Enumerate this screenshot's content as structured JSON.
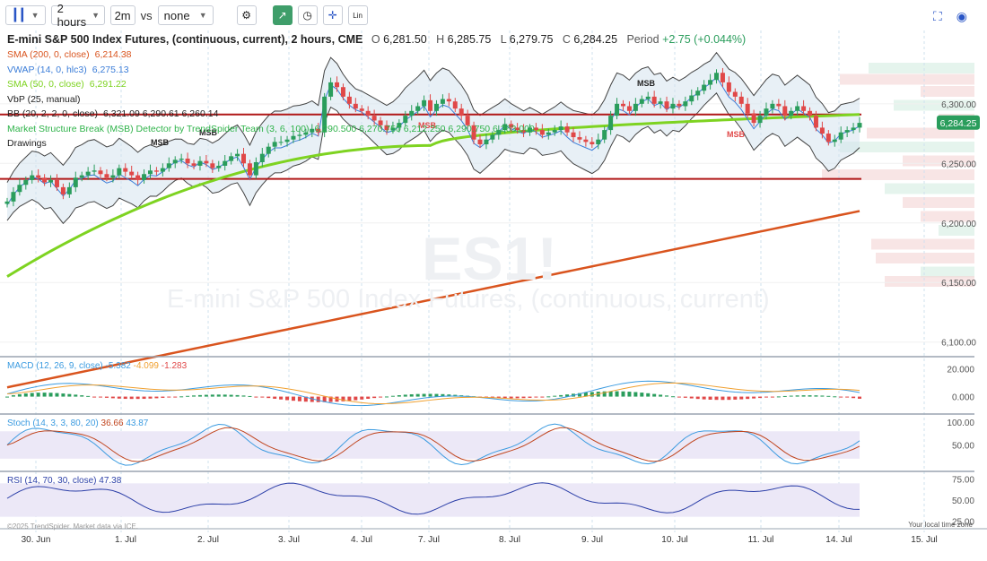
{
  "toolbar": {
    "interval": "2 hours",
    "interval_short": "2m",
    "vs_label": "vs",
    "compare": "none",
    "scale_label": "Lin"
  },
  "header": {
    "title": "E-mini S&P 500 Index Futures, (continuous, current), 2 hours, CME",
    "o_label": "O",
    "o": "6,281.50",
    "h_label": "H",
    "h": "6,285.75",
    "l_label": "L",
    "l": "6,279.75",
    "c_label": "C",
    "c": "6,284.25",
    "period_label": "Period",
    "period": "+2.75 (+0.044%)"
  },
  "legend": [
    {
      "label": "SMA (200, 0, close)",
      "value": "6,214.38",
      "color": "#d9541e"
    },
    {
      "label": "VWAP (14, 0, hlc3)",
      "value": "6,275.13",
      "color": "#3b7dd8"
    },
    {
      "label": "SMA (50, 0, close)",
      "value": "6,291.22",
      "color": "#7ed321"
    },
    {
      "label": "VbP (25, manual)",
      "value": "",
      "color": "#222"
    },
    {
      "label": "BB (20, 2, 2, 0, close)",
      "value": "6,321.09 6,290.61 6,260.14",
      "color": "#222"
    },
    {
      "label": "Market Structure Break (MSB) Detector by TrendSpider Team (3, 6, 100)",
      "value": "6,290.500 6,270.750 6,212.250 6,290.750 6,263.000",
      "color": "#2fb34a"
    },
    {
      "label": "Drawings",
      "value": "",
      "color": "#222"
    }
  ],
  "watermark": {
    "ticker": "ES1!",
    "name": "E-mini S&P 500 Index Futures, (continuous, current)"
  },
  "indicators": {
    "macd": {
      "label": "MACD (12, 26, 9, close)",
      "v1": "-5.382",
      "v2": "-4.099",
      "v3": "-1.283"
    },
    "stoch": {
      "label": "Stoch (14, 3, 3, 80, 20)",
      "v1": "36.66",
      "v2": "43.87"
    },
    "rsi": {
      "label": "RSI (14, 70, 30, close)",
      "v1": "47.38"
    }
  },
  "footer": {
    "copyright": "©2025 TrendSpider. Market data via ICE.",
    "timezone": "Your local time zone"
  },
  "colors": {
    "up": "#2a9d5c",
    "down": "#e04848",
    "sma200": "#d9541e",
    "sma50": "#7ed321",
    "vwap": "#3b7dd8",
    "bb": "#444",
    "macd_line": "#3b9be0",
    "signal_line": "#f0a030",
    "stoch_k": "#3b9be0",
    "stoch_d": "#c0451e",
    "rsi_line": "#2c3fa8",
    "support": "#b01818"
  },
  "chart_data": [
    {
      "type": "line",
      "title": "E-mini S&P 500 Index Futures, (continuous, current), 2 hours, CME",
      "x_ticks": [
        "30. Jun",
        "1. Jul",
        "2. Jul",
        "3. Jul",
        "4. Jul",
        "7. Jul",
        "8. Jul",
        "9. Jul",
        "10. Jul",
        "11. Jul",
        "14. Jul",
        "15. Jul"
      ],
      "y_ticks": [
        6100,
        6150,
        6200,
        6250,
        6300
      ],
      "ylim": [
        6090,
        6342
      ],
      "last_price": "6,284.25",
      "last_value": 6284.25,
      "horizontal_levels": [
        6291,
        6237
      ],
      "close_series": [
        6218,
        6226,
        6232,
        6236,
        6240,
        6238,
        6234,
        6236,
        6230,
        6224,
        6230,
        6238,
        6240,
        6243,
        6244,
        6241,
        6238,
        6240,
        6246,
        6243,
        6240,
        6236,
        6241,
        6244,
        6243,
        6246,
        6250,
        6253,
        6254,
        6250,
        6248,
        6252,
        6250,
        6246,
        6248,
        6252,
        6256,
        6258,
        6250,
        6240,
        6251,
        6258,
        6264,
        6268,
        6268,
        6270,
        6273,
        6274,
        6276,
        6279,
        6276,
        6306,
        6318,
        6314,
        6306,
        6300,
        6296,
        6294,
        6290,
        6286,
        6282,
        6278,
        6280,
        6284,
        6290,
        6294,
        6298,
        6303,
        6294,
        6300,
        6304,
        6302,
        6296,
        6290,
        6282,
        6270,
        6266,
        6270,
        6274,
        6278,
        6283,
        6280,
        6278,
        6276,
        6280,
        6278,
        6274,
        6276,
        6278,
        6281,
        6276,
        6272,
        6270,
        6268,
        6266,
        6270,
        6278,
        6290,
        6300,
        6298,
        6294,
        6300,
        6304,
        6306,
        6300,
        6302,
        6296,
        6300,
        6298,
        6302,
        6307,
        6311,
        6316,
        6320,
        6326,
        6318,
        6310,
        6306,
        6300,
        6292,
        6284,
        6290,
        6296,
        6300,
        6298,
        6290,
        6294,
        6298,
        6294,
        6290,
        6280,
        6275,
        6268,
        6270,
        6276,
        6278,
        6280,
        6284
      ],
      "sma200": {
        "start": 6062,
        "end": 6210
      },
      "sma50": {
        "start": 6155,
        "mid": 6265,
        "end": 6291
      },
      "macd": {
        "ylim": [
          -10,
          25
        ],
        "ticks": [
          0,
          20
        ]
      },
      "stoch": {
        "ylim": [
          0,
          110
        ],
        "ticks": [
          50,
          100
        ],
        "bands": [
          20,
          80
        ]
      },
      "rsi": {
        "ylim": [
          20,
          80
        ],
        "ticks": [
          25,
          50,
          75
        ],
        "bands": [
          30,
          70
        ]
      },
      "annotations": [
        "MSB",
        "MSB",
        "MSB",
        "MSB",
        "MSB"
      ]
    }
  ]
}
